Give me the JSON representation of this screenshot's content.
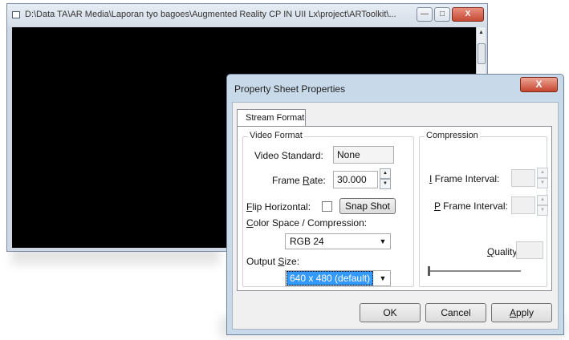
{
  "console": {
    "title": "D:\\Data TA\\AR Media\\Laporan tyo bagoes\\Augmented Reality CP IN UII Lx\\project\\ARToolkit\\...",
    "minimize": "—",
    "maximize": "□",
    "close": "X"
  },
  "dialog": {
    "title": "Property Sheet Properties",
    "close": "X",
    "tab": "Stream Format",
    "video_format": {
      "legend": "Video Format",
      "standard_label": "Video Standard:",
      "standard_value": "None",
      "frame_rate_label_pre": "Frame ",
      "frame_rate_label_ul": "R",
      "frame_rate_label_post": "ate:",
      "frame_rate_value": "30.000",
      "flip_label_ul": "F",
      "flip_label_post": "lip Horizontal:",
      "snap_button": "Snap Shot",
      "color_label_ul": "C",
      "color_label_post": "olor Space / Compression:",
      "color_value": "RGB 24",
      "output_label_pre": "Output ",
      "output_label_ul": "S",
      "output_label_post": "ize:",
      "output_value": "640 x 480  (default)"
    },
    "compression": {
      "legend": "Compression",
      "i_label_ul": "I",
      "i_label_post": " Frame Interval:",
      "p_label_ul": "P",
      "p_label_post": " Frame Interval:",
      "quality_label_ul": "Q",
      "quality_label_post": "uality:"
    },
    "buttons": {
      "ok": "OK",
      "cancel": "Cancel",
      "apply_ul": "A",
      "apply_post": "pply"
    }
  }
}
